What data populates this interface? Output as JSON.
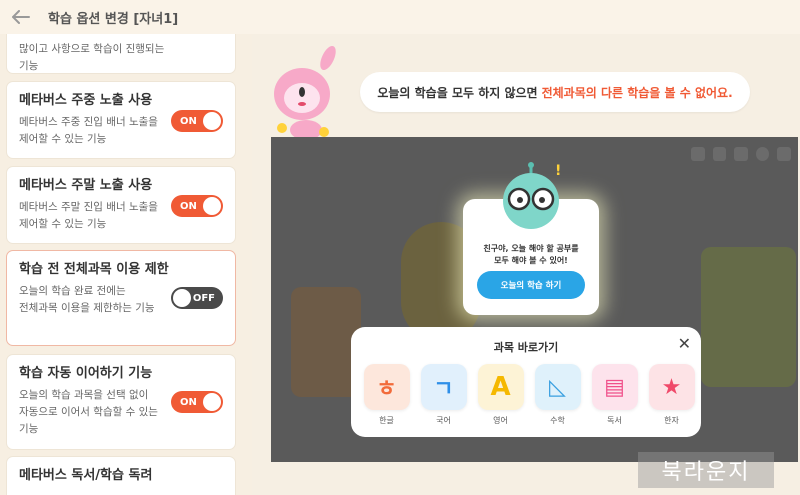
{
  "header": {
    "title": "학습 옵션 변경 [자녀1]"
  },
  "settings": [
    {
      "title": "",
      "desc": [
        "많이고 사항으로 학습이 진행되는",
        "기능"
      ],
      "toggle": ""
    },
    {
      "title": "메타버스 주중 노출 사용",
      "desc": [
        "메타버스 주중 진입 배너 노출을",
        "제어할 수 있는 기능"
      ],
      "toggle": "ON"
    },
    {
      "title": "메타버스 주말 노출 사용",
      "desc": [
        "메타버스 주말 진입 배너 노출을",
        "제어할 수 있는 기능"
      ],
      "toggle": "ON"
    },
    {
      "title": "학습 전 전체과목 이용 제한",
      "desc": [
        "오늘의 학습 완료 전에는",
        "전체과목 이용을 제한하는 기능"
      ],
      "toggle": "OFF"
    },
    {
      "title": "학습 자동 이어하기 기능",
      "desc": [
        "오늘의 학습 과목을 선택 없이",
        "자동으로 이어서 학습할 수 있는",
        "기능"
      ],
      "toggle": "ON"
    },
    {
      "title": "메타버스 독서/학습 독려",
      "desc": [],
      "toggle": ""
    }
  ],
  "speech": {
    "text": "오늘의 학습을 모두 하지 않으면",
    "highlight": "전체과목의 다른 학습을 볼 수 없어요."
  },
  "popup": {
    "line1": "친구야, 오늘 해야 할 공부를",
    "line2": "모두 해야 볼 수 있어!",
    "button": "오늘의 학습 하기"
  },
  "subject_panel": {
    "title": "과목 바로가기",
    "subjects": [
      {
        "label": "한글",
        "glyph": "ㅎ",
        "color": "#f26b3a",
        "bg": "#fde7dc"
      },
      {
        "label": "국어",
        "glyph": "ㄱ",
        "color": "#2e8fe8",
        "bg": "#e1f0fc"
      },
      {
        "label": "영어",
        "glyph": "A",
        "color": "#f5b800",
        "bg": "#fdf3d6"
      },
      {
        "label": "수학",
        "glyph": "◺",
        "color": "#3aa0e0",
        "bg": "#dff1fb"
      },
      {
        "label": "독서",
        "glyph": "▤",
        "color": "#f0508a",
        "bg": "#fde3ec"
      },
      {
        "label": "한자",
        "glyph": "★",
        "color": "#f04a6a",
        "bg": "#fde3e6"
      }
    ]
  },
  "watermark": "북라운지"
}
